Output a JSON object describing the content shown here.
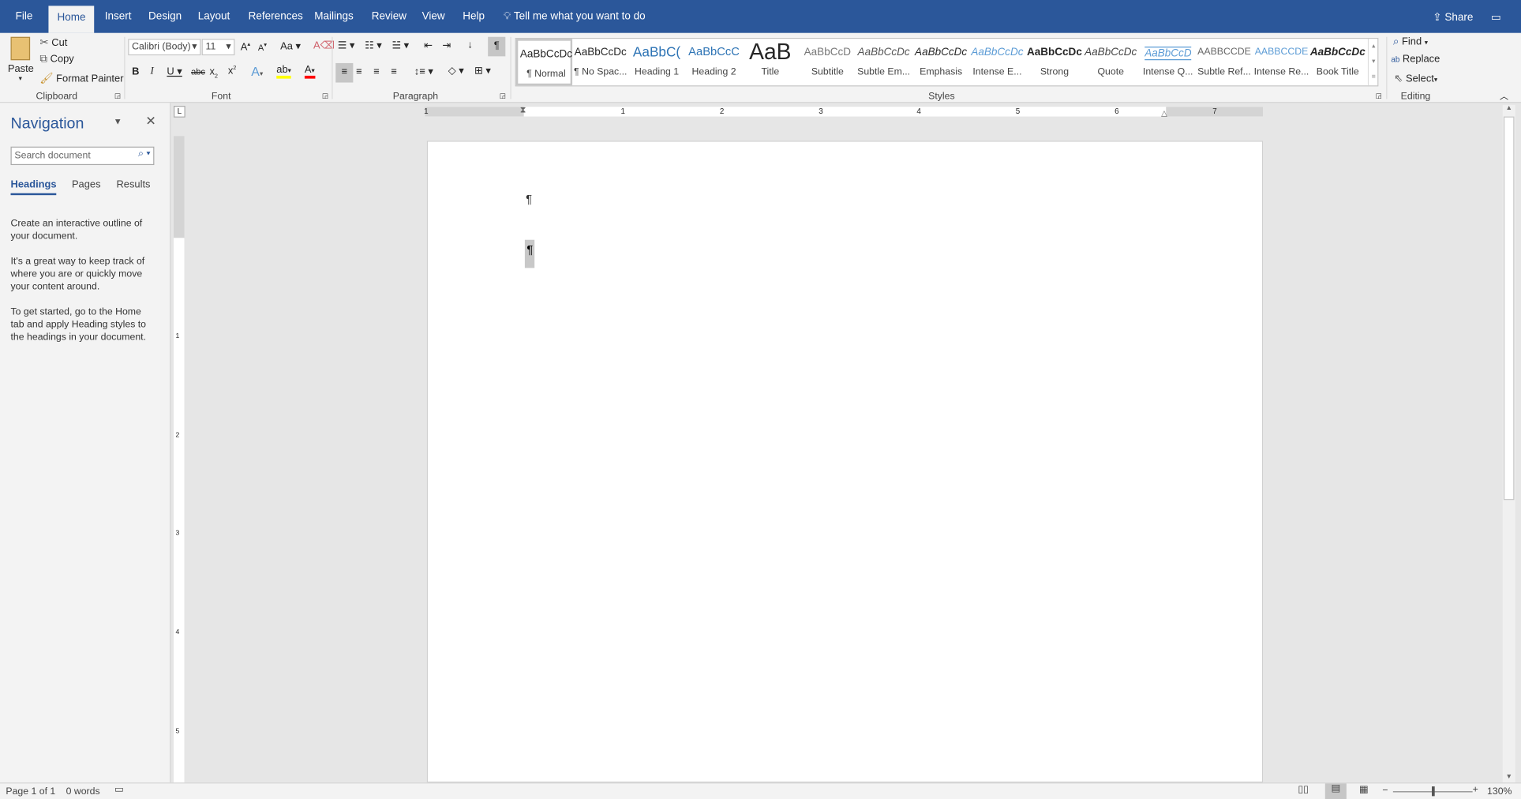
{
  "tabs": [
    "File",
    "Home",
    "Insert",
    "Design",
    "Layout",
    "References",
    "Mailings",
    "Review",
    "View",
    "Help"
  ],
  "tell_me": "Tell me what you want to do",
  "share": "Share",
  "clipboard": {
    "paste": "Paste",
    "cut": "Cut",
    "copy": "Copy",
    "format_painter": "Format Painter",
    "label": "Clipboard"
  },
  "font": {
    "name": "Calibri (Body)",
    "size": "11",
    "label": "Font"
  },
  "paragraph": {
    "label": "Paragraph"
  },
  "styles": {
    "label": "Styles",
    "items": [
      {
        "preview": "AaBbCcDc",
        "name": "¶ Normal"
      },
      {
        "preview": "AaBbCcDc",
        "name": "¶ No Spac..."
      },
      {
        "preview": "AaBbC(",
        "name": "Heading 1"
      },
      {
        "preview": "AaBbCcC",
        "name": "Heading 2"
      },
      {
        "preview": "AaB",
        "name": "Title"
      },
      {
        "preview": "AaBbCcD",
        "name": "Subtitle"
      },
      {
        "preview": "AaBbCcDc",
        "name": "Subtle Em..."
      },
      {
        "preview": "AaBbCcDc",
        "name": "Emphasis"
      },
      {
        "preview": "AaBbCcDc",
        "name": "Intense E..."
      },
      {
        "preview": "AaBbCcDc",
        "name": "Strong"
      },
      {
        "preview": "AaBbCcDc",
        "name": "Quote"
      },
      {
        "preview": "AaBbCcDc",
        "name": "Intense Q..."
      },
      {
        "preview": "AABBCCDE",
        "name": "Subtle Ref..."
      },
      {
        "preview": "AABBCCDE",
        "name": "Intense Re..."
      },
      {
        "preview": "AaBbCcDc",
        "name": "Book Title"
      }
    ]
  },
  "editing": {
    "find": "Find",
    "replace": "Replace",
    "select": "Select",
    "label": "Editing"
  },
  "navigation": {
    "title": "Navigation",
    "search_placeholder": "Search document",
    "tabs": [
      "Headings",
      "Pages",
      "Results"
    ],
    "p1": "Create an interactive outline of your document.",
    "p2": "It's a great way to keep track of where you are or quickly move your content around.",
    "p3": "To get started, go to the Home tab and apply Heading styles to the headings in your document."
  },
  "document": {
    "mark": "¶"
  },
  "ruler": {
    "h": [
      "1",
      "1",
      "2",
      "3",
      "4",
      "5",
      "6",
      "7"
    ],
    "v": [
      "1",
      "2",
      "3",
      "4",
      "5"
    ]
  },
  "status": {
    "page": "Page 1 of 1",
    "words": "0 words",
    "zoom": "130%"
  },
  "colors": {
    "accent": "#2b579a",
    "highlight": "#ffff00",
    "font_color": "#ff0000"
  }
}
